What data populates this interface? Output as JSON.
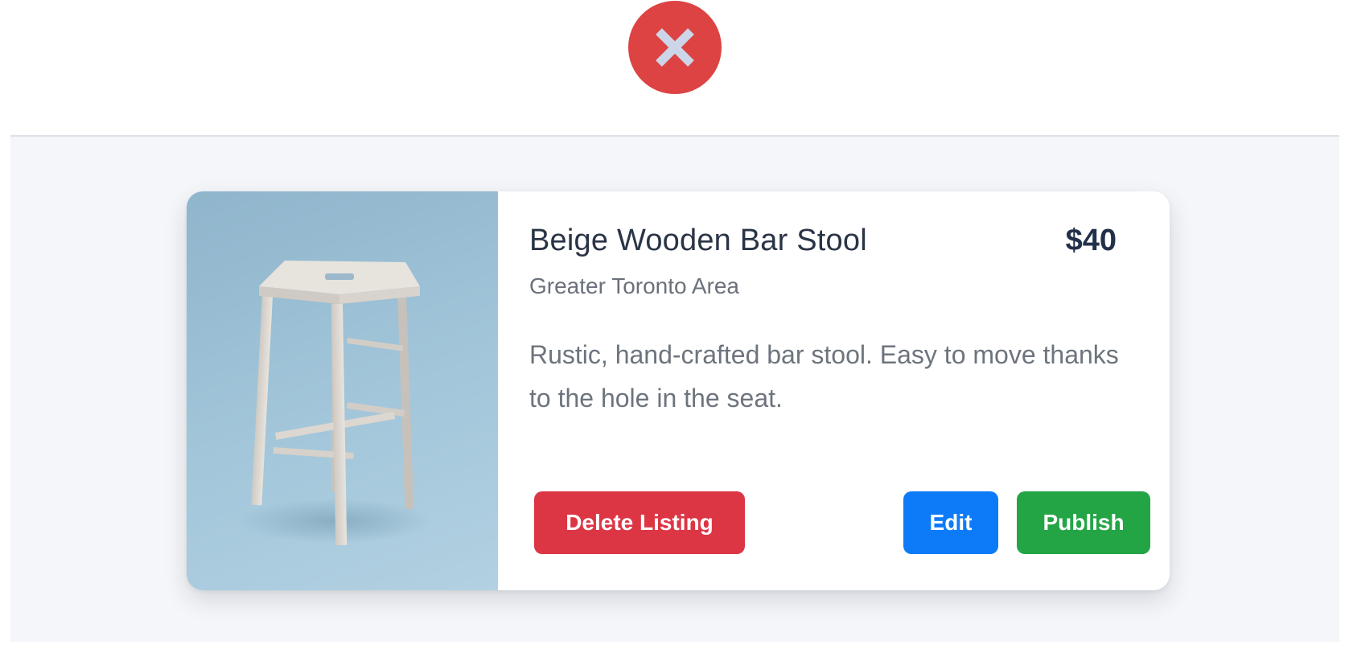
{
  "dismiss": {
    "icon": "close-icon",
    "color": "#dc4342"
  },
  "listing": {
    "image_alt": "Beige wooden bar stool on blue background",
    "title": "Beige Wooden Bar Stool",
    "price": "$40",
    "location": "Greater Toronto Area",
    "description": "Rustic, hand-crafted bar stool. Easy to move thanks to the hole in the seat."
  },
  "actions": {
    "delete_label": "Delete Listing",
    "edit_label": "Edit",
    "publish_label": "Publish"
  },
  "colors": {
    "danger": "#dc3645",
    "primary": "#0d7bf7",
    "success": "#23a546",
    "background": "#f4f6f9"
  }
}
